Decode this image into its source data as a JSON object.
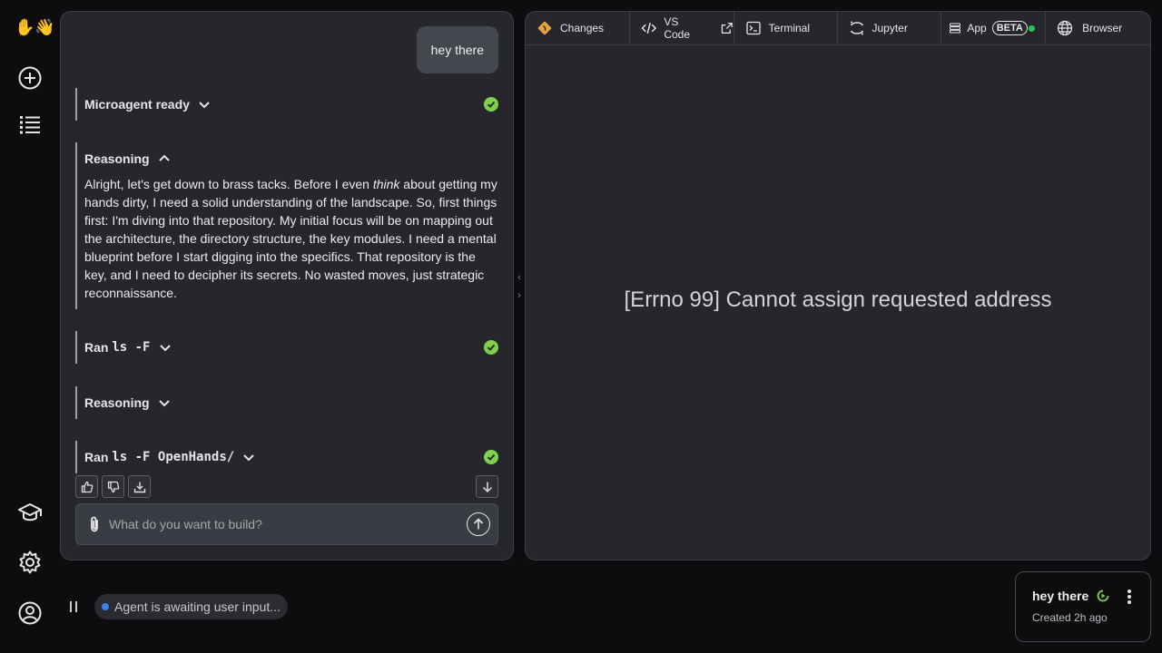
{
  "sidebar": {
    "logo_emoji": "✋👋",
    "top_icons": [
      "plus-circle-icon",
      "list-icon"
    ],
    "bottom_icons": [
      "graduation-cap-icon",
      "gear-icon",
      "user-icon"
    ]
  },
  "chat": {
    "user_message": "hey there",
    "events": [
      {
        "type": "status",
        "label": "Microagent ready",
        "success": true
      },
      {
        "type": "reasoning",
        "label": "Reasoning",
        "expanded": true,
        "text_before": "Alright, let's get down to brass tacks. Before I even ",
        "text_emphasis": "think",
        "text_after": " about getting my hands dirty, I need a solid understanding of the landscape. So, first things first: I'm diving into that repository. My initial focus will be on mapping out the architecture, the directory structure, the key modules. I need a mental blueprint before I start digging into the specifics. That repository is the key, and I need to decipher its secrets. No wasted moves, just strategic reconnaissance."
      },
      {
        "type": "command",
        "prefix": "Ran",
        "command": "ls -F",
        "success": true
      },
      {
        "type": "reasoning",
        "label": "Reasoning",
        "expanded": false
      },
      {
        "type": "command",
        "prefix": "Ran",
        "command": "ls -F OpenHands/",
        "success": true
      }
    ],
    "composer": {
      "placeholder": "What do you want to build?"
    }
  },
  "workspace": {
    "tabs": [
      {
        "label": "Changes",
        "icon": "git-diff-icon"
      },
      {
        "label": "VS Code",
        "icon": "code-icon",
        "external": true
      },
      {
        "label": "Terminal",
        "icon": "terminal-icon"
      },
      {
        "label": "Jupyter",
        "icon": "jupyter-icon"
      },
      {
        "label": "App",
        "icon": "server-icon",
        "badge": "BETA",
        "status_color": "#22c55e"
      },
      {
        "label": "Browser",
        "icon": "globe-icon"
      }
    ],
    "error_message": "[Errno 99] Cannot assign requested address"
  },
  "bottom": {
    "agent_status": "Agent is awaiting user input...",
    "status_color": "#3b82f6",
    "conversation": {
      "title": "hey there",
      "created": "Created 2h ago"
    }
  },
  "colors": {
    "success": "#7fd14a",
    "panel": "#25272d",
    "background": "#0d0d0f"
  }
}
